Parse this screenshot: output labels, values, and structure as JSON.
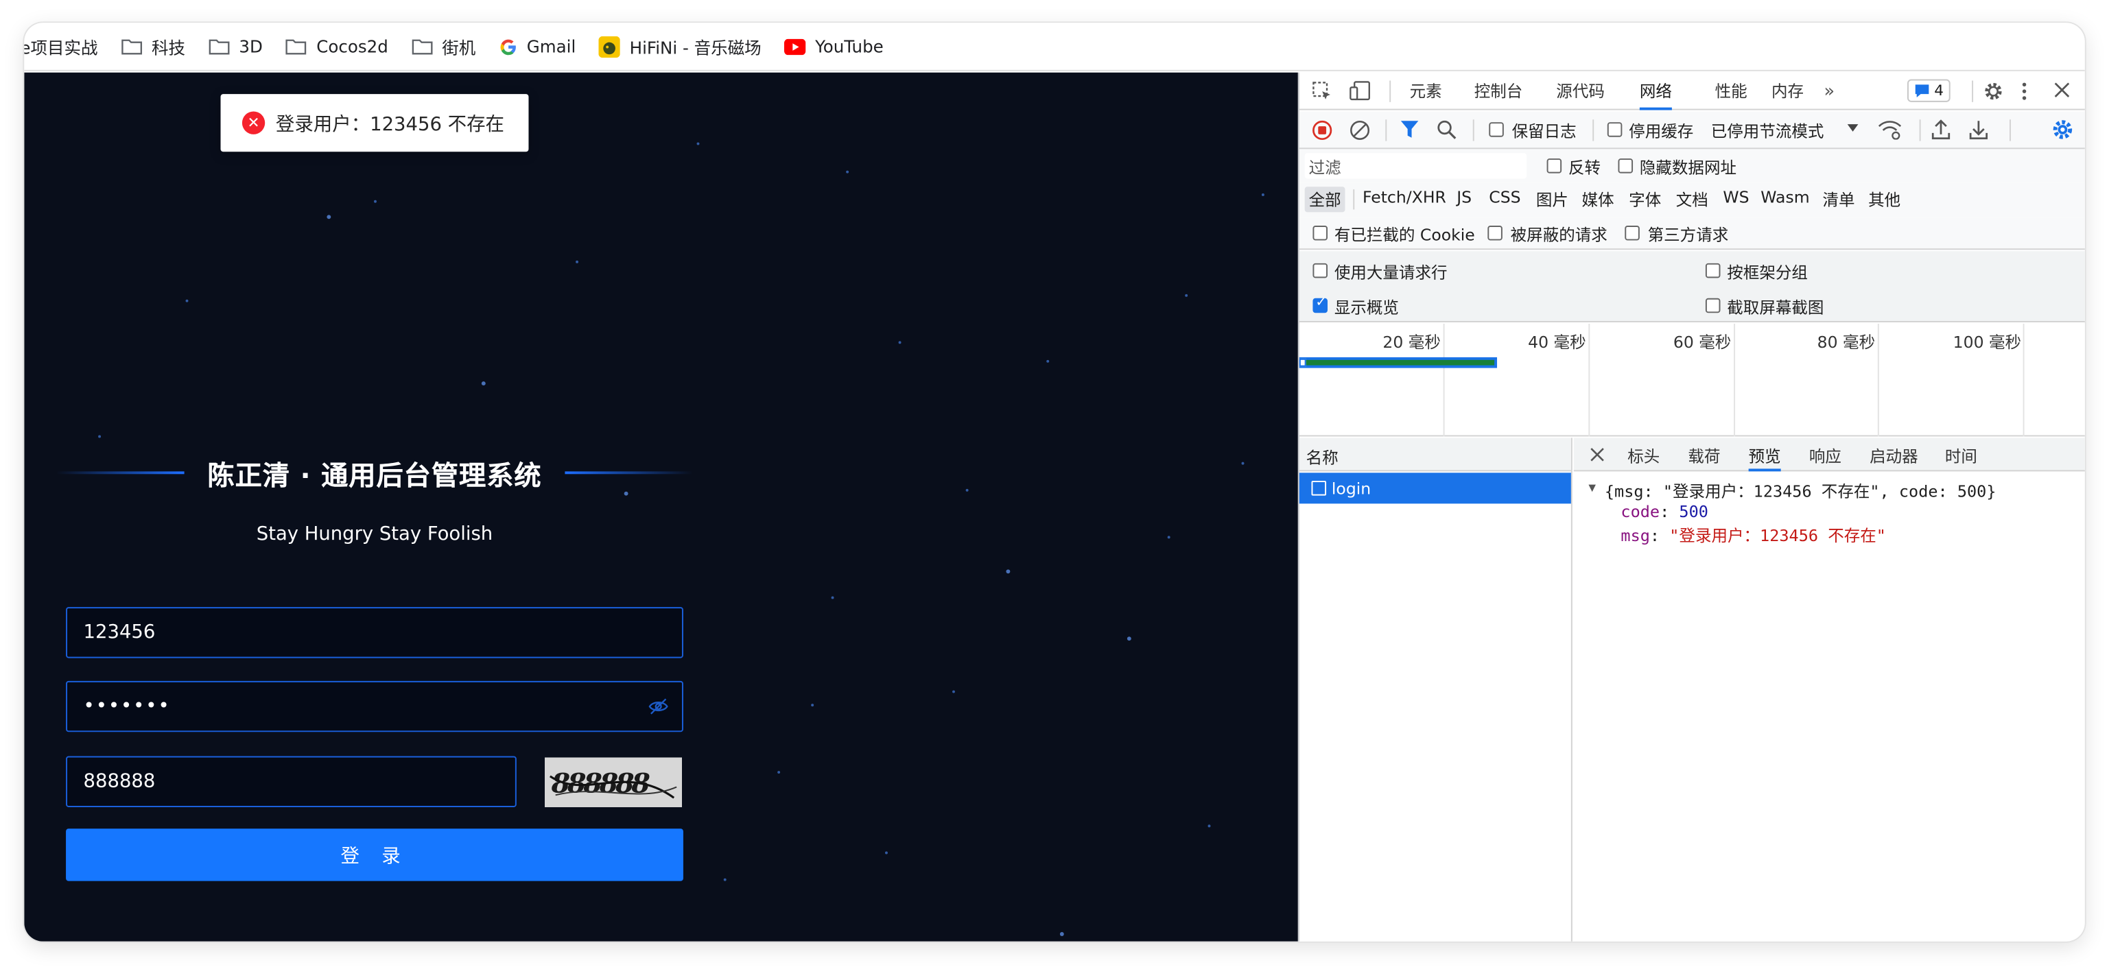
{
  "bookmarks": {
    "items": [
      {
        "label": "e项目实战",
        "icon": "folder-icon"
      },
      {
        "label": "科技",
        "icon": "folder-icon"
      },
      {
        "label": "3D",
        "icon": "folder-icon"
      },
      {
        "label": "Cocos2d",
        "icon": "folder-icon"
      },
      {
        "label": "街机",
        "icon": "folder-icon"
      },
      {
        "label": "Gmail",
        "icon": "google-icon"
      },
      {
        "label": "HiFiNi - 音乐磁场",
        "icon": "hifini-icon"
      },
      {
        "label": "YouTube",
        "icon": "youtube-icon"
      }
    ]
  },
  "login": {
    "toast": "登录用户：123456 不存在",
    "title": "陈正清 · 通用后台管理系统",
    "subtitle": "Stay Hungry Stay Foolish",
    "username": "123456",
    "password_mask": "•••••••",
    "captcha_value": "888888",
    "submit_label": "登 录",
    "colors": {
      "background": "#090e1b",
      "accent": "#1677ff",
      "error": "#f5222d"
    }
  },
  "devtools": {
    "tabs": [
      "元素",
      "控制台",
      "源代码",
      "网络",
      "性能",
      "内存"
    ],
    "active_tab": "网络",
    "issues_count": "4",
    "toolbar": {
      "preserve_log": "保留日志",
      "disable_cache": "停用缓存",
      "throttling": "已停用节流模式"
    },
    "filter": {
      "placeholder": "过滤",
      "invert": "反转",
      "hide_data_urls": "隐藏数据网址"
    },
    "types": [
      "全部",
      "Fetch/XHR",
      "JS",
      "CSS",
      "图片",
      "媒体",
      "字体",
      "文档",
      "WS",
      "Wasm",
      "清单",
      "其他"
    ],
    "blocked": {
      "blocked_cookies": "有已拦截的 Cookie",
      "blocked_requests": "被屏蔽的请求",
      "third_party": "第三方请求"
    },
    "settings": {
      "large_rows": "使用大量请求行",
      "group_by_frame": "按框架分组",
      "show_overview": "显示概览",
      "capture_screenshots": "截取屏幕截图"
    },
    "timeline_ticks": [
      "20 毫秒",
      "40 毫秒",
      "60 毫秒",
      "80 毫秒",
      "100 毫秒"
    ],
    "requests_header": "名称",
    "requests": [
      {
        "name": "login"
      }
    ],
    "detail_tabs": [
      "标头",
      "载荷",
      "预览",
      "响应",
      "启动器",
      "时间"
    ],
    "active_detail_tab": "预览",
    "preview": {
      "summary": "{msg: \"登录用户：123456 不存在\", code: 500}",
      "code_key": "code",
      "code_value": "500",
      "msg_key": "msg",
      "msg_value": "\"登录用户：123456 不存在\""
    }
  }
}
